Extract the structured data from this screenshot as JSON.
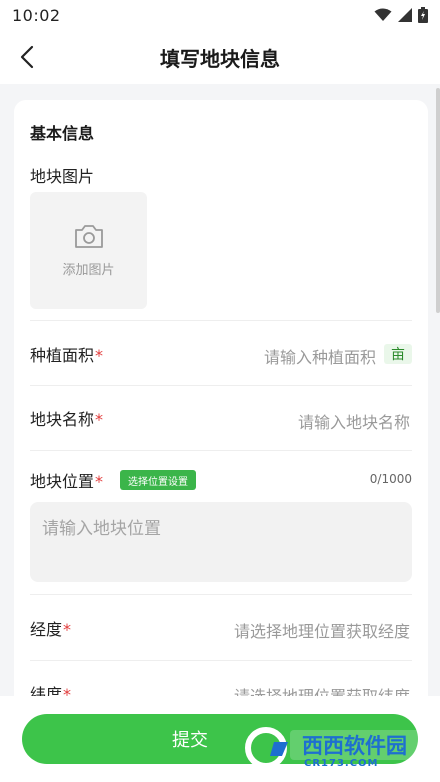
{
  "status_bar": {
    "time": "10:02"
  },
  "nav": {
    "title": "填写地块信息"
  },
  "form": {
    "section_title": "基本信息",
    "photo_label": "地块图片",
    "add_photo_text": "添加图片",
    "area": {
      "label": "种植面积",
      "required": "*",
      "placeholder": "请输入种植面积",
      "unit": "亩"
    },
    "name": {
      "label": "地块名称",
      "required": "*",
      "placeholder": "请输入地块名称"
    },
    "location": {
      "label": "地块位置",
      "required": "*",
      "select_button": "选择位置设置",
      "char_count": "0/1000",
      "placeholder": "请输入地块位置"
    },
    "longitude": {
      "label": "经度",
      "required": "*",
      "placeholder": "请选择地理位置获取经度"
    },
    "latitude": {
      "label": "纬度",
      "required": "*",
      "placeholder": "请选择地理位置获取纬度"
    }
  },
  "submit_label": "提交",
  "watermark_text": "西西软件园",
  "watermark_sub": "CR173.COM",
  "colors": {
    "accent": "#3dc44a",
    "required": "#e23b3b",
    "tag_green": "#3bb54a"
  }
}
